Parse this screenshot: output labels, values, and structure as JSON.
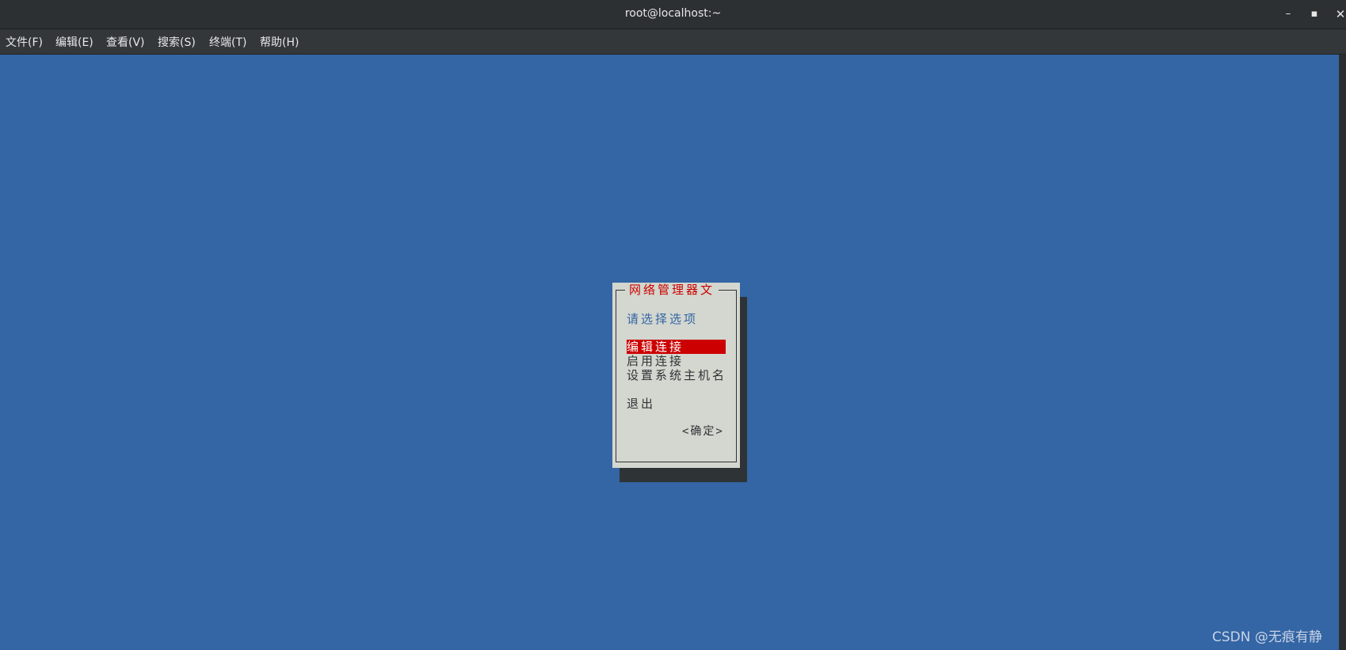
{
  "window": {
    "title": "root@localhost:~",
    "minimize_glyph": "–",
    "maximize_glyph": "▪",
    "close_glyph": "✕"
  },
  "menu": [
    {
      "label": "文件(F)"
    },
    {
      "label": "编辑(E)"
    },
    {
      "label": "查看(V)"
    },
    {
      "label": "搜索(S)"
    },
    {
      "label": "终端(T)"
    },
    {
      "label": "帮助(H)"
    }
  ],
  "dialog": {
    "title": "网络管理器文",
    "prompt": "请选择选项",
    "options": [
      {
        "label": "编辑连接",
        "selected": true
      },
      {
        "label": "启用连接",
        "selected": false
      },
      {
        "label": "设置系统主机名",
        "selected": false
      },
      {
        "label": "退出",
        "selected": false
      }
    ],
    "ok_label": "<确定>"
  },
  "watermark": "CSDN @无痕有静",
  "colors": {
    "terminal_bg": "#3465a4",
    "dialog_bg": "#d3d7cf",
    "accent_red": "#cc0000",
    "titlebar_bg": "#2d3032"
  }
}
